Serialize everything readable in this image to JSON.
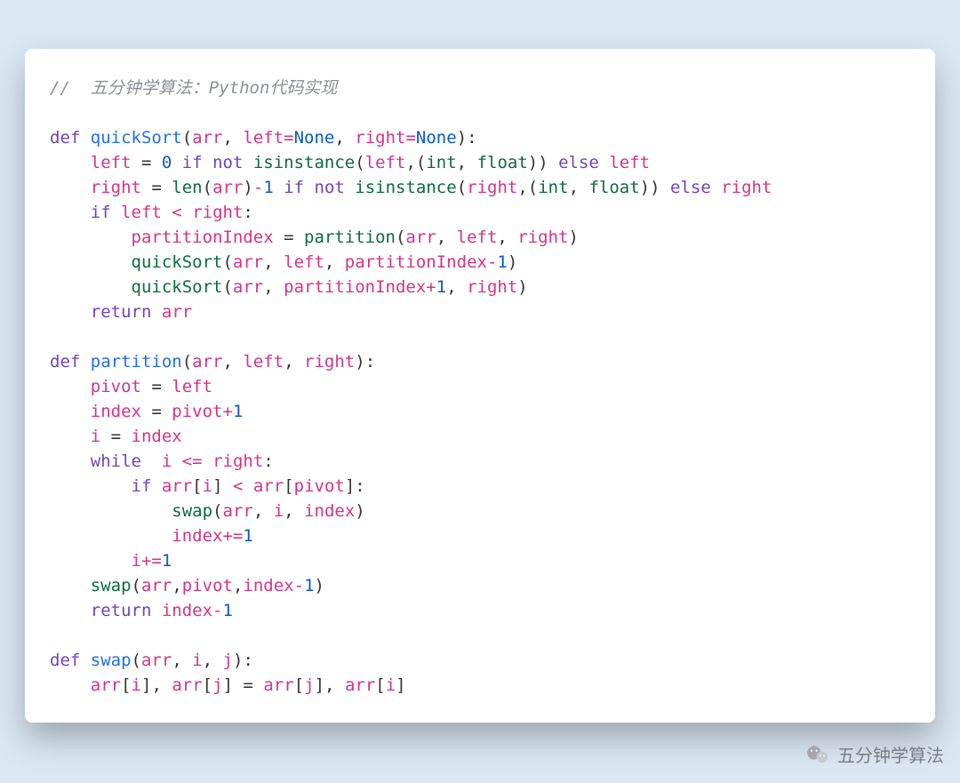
{
  "code": {
    "language": "python",
    "comment": "//  五分钟学算法：Python代码实现",
    "lines_plain": [
      "// 五分钟学算法：Python代码实现",
      "",
      "def quickSort(arr, left=None, right=None):",
      "    left = 0 if not isinstance(left,(int, float)) else left",
      "    right = len(arr)-1 if not isinstance(right,(int, float)) else right",
      "    if left < right:",
      "        partitionIndex = partition(arr, left, right)",
      "        quickSort(arr, left, partitionIndex-1)",
      "        quickSort(arr, partitionIndex+1, right)",
      "    return arr",
      "",
      "def partition(arr, left, right):",
      "    pivot = left",
      "    index = pivot+1",
      "    i = index",
      "    while  i <= right:",
      "        if arr[i] < arr[pivot]:",
      "            swap(arr, i, index)",
      "            index+=1",
      "        i+=1",
      "    swap(arr,pivot,index-1)",
      "    return index-1",
      "",
      "def swap(arr, i, j):",
      "    arr[i], arr[j] = arr[j], arr[i]"
    ],
    "lines": [
      [
        {
          "t": "//  五分钟学算法：Python代码实现",
          "c": "tok-comment"
        }
      ],
      [],
      [
        {
          "t": "def ",
          "c": "tok-kw"
        },
        {
          "t": "quickSort",
          "c": "tok-fn"
        },
        {
          "t": "(",
          "c": "tok-paren"
        },
        {
          "t": "arr",
          "c": "tok-name"
        },
        {
          "t": ", "
        },
        {
          "t": "left",
          "c": "tok-name"
        },
        {
          "t": "=",
          "c": "tok-op"
        },
        {
          "t": "None",
          "c": "tok-const"
        },
        {
          "t": ", "
        },
        {
          "t": "right",
          "c": "tok-name"
        },
        {
          "t": "=",
          "c": "tok-op"
        },
        {
          "t": "None",
          "c": "tok-const"
        },
        {
          "t": "):",
          "c": "tok-paren"
        }
      ],
      [
        {
          "t": "    "
        },
        {
          "t": "left",
          "c": "tok-name"
        },
        {
          "t": " = "
        },
        {
          "t": "0",
          "c": "tok-num"
        },
        {
          "t": " "
        },
        {
          "t": "if not ",
          "c": "tok-kw"
        },
        {
          "t": "isinstance",
          "c": "tok-call"
        },
        {
          "t": "(",
          "c": "tok-paren"
        },
        {
          "t": "left",
          "c": "tok-name"
        },
        {
          "t": ",("
        },
        {
          "t": "int",
          "c": "tok-call"
        },
        {
          "t": ", "
        },
        {
          "t": "float",
          "c": "tok-call"
        },
        {
          "t": "))",
          "c": "tok-paren"
        },
        {
          "t": " "
        },
        {
          "t": "else ",
          "c": "tok-kw"
        },
        {
          "t": "left",
          "c": "tok-name"
        }
      ],
      [
        {
          "t": "    "
        },
        {
          "t": "right",
          "c": "tok-name"
        },
        {
          "t": " = "
        },
        {
          "t": "len",
          "c": "tok-call"
        },
        {
          "t": "(",
          "c": "tok-paren"
        },
        {
          "t": "arr",
          "c": "tok-name"
        },
        {
          "t": ")",
          "c": "tok-paren"
        },
        {
          "t": "-",
          "c": "tok-op"
        },
        {
          "t": "1",
          "c": "tok-num"
        },
        {
          "t": " "
        },
        {
          "t": "if not ",
          "c": "tok-kw"
        },
        {
          "t": "isinstance",
          "c": "tok-call"
        },
        {
          "t": "(",
          "c": "tok-paren"
        },
        {
          "t": "right",
          "c": "tok-name"
        },
        {
          "t": ",("
        },
        {
          "t": "int",
          "c": "tok-call"
        },
        {
          "t": ", "
        },
        {
          "t": "float",
          "c": "tok-call"
        },
        {
          "t": "))",
          "c": "tok-paren"
        },
        {
          "t": " "
        },
        {
          "t": "else ",
          "c": "tok-kw"
        },
        {
          "t": "right",
          "c": "tok-name"
        }
      ],
      [
        {
          "t": "    "
        },
        {
          "t": "if ",
          "c": "tok-kw"
        },
        {
          "t": "left",
          "c": "tok-name"
        },
        {
          "t": " < ",
          "c": "tok-op"
        },
        {
          "t": "right",
          "c": "tok-name"
        },
        {
          "t": ":",
          "c": "tok-paren"
        }
      ],
      [
        {
          "t": "        "
        },
        {
          "t": "partitionIndex",
          "c": "tok-name"
        },
        {
          "t": " = "
        },
        {
          "t": "partition",
          "c": "tok-call"
        },
        {
          "t": "(",
          "c": "tok-paren"
        },
        {
          "t": "arr",
          "c": "tok-name"
        },
        {
          "t": ", "
        },
        {
          "t": "left",
          "c": "tok-name"
        },
        {
          "t": ", "
        },
        {
          "t": "right",
          "c": "tok-name"
        },
        {
          "t": ")",
          "c": "tok-paren"
        }
      ],
      [
        {
          "t": "        "
        },
        {
          "t": "quickSort",
          "c": "tok-call"
        },
        {
          "t": "(",
          "c": "tok-paren"
        },
        {
          "t": "arr",
          "c": "tok-name"
        },
        {
          "t": ", "
        },
        {
          "t": "left",
          "c": "tok-name"
        },
        {
          "t": ", "
        },
        {
          "t": "partitionIndex",
          "c": "tok-name"
        },
        {
          "t": "-",
          "c": "tok-op"
        },
        {
          "t": "1",
          "c": "tok-num"
        },
        {
          "t": ")",
          "c": "tok-paren"
        }
      ],
      [
        {
          "t": "        "
        },
        {
          "t": "quickSort",
          "c": "tok-call"
        },
        {
          "t": "(",
          "c": "tok-paren"
        },
        {
          "t": "arr",
          "c": "tok-name"
        },
        {
          "t": ", "
        },
        {
          "t": "partitionIndex",
          "c": "tok-name"
        },
        {
          "t": "+",
          "c": "tok-op"
        },
        {
          "t": "1",
          "c": "tok-num"
        },
        {
          "t": ", "
        },
        {
          "t": "right",
          "c": "tok-name"
        },
        {
          "t": ")",
          "c": "tok-paren"
        }
      ],
      [
        {
          "t": "    "
        },
        {
          "t": "return ",
          "c": "tok-kw"
        },
        {
          "t": "arr",
          "c": "tok-name"
        }
      ],
      [],
      [
        {
          "t": "def ",
          "c": "tok-kw"
        },
        {
          "t": "partition",
          "c": "tok-fn"
        },
        {
          "t": "(",
          "c": "tok-paren"
        },
        {
          "t": "arr",
          "c": "tok-name"
        },
        {
          "t": ", "
        },
        {
          "t": "left",
          "c": "tok-name"
        },
        {
          "t": ", "
        },
        {
          "t": "right",
          "c": "tok-name"
        },
        {
          "t": "):",
          "c": "tok-paren"
        }
      ],
      [
        {
          "t": "    "
        },
        {
          "t": "pivot",
          "c": "tok-name"
        },
        {
          "t": " = "
        },
        {
          "t": "left",
          "c": "tok-name"
        }
      ],
      [
        {
          "t": "    "
        },
        {
          "t": "index",
          "c": "tok-name"
        },
        {
          "t": " = "
        },
        {
          "t": "pivot",
          "c": "tok-name"
        },
        {
          "t": "+",
          "c": "tok-op"
        },
        {
          "t": "1",
          "c": "tok-num"
        }
      ],
      [
        {
          "t": "    "
        },
        {
          "t": "i",
          "c": "tok-name"
        },
        {
          "t": " = "
        },
        {
          "t": "index",
          "c": "tok-name"
        }
      ],
      [
        {
          "t": "    "
        },
        {
          "t": "while  ",
          "c": "tok-kw"
        },
        {
          "t": "i",
          "c": "tok-name"
        },
        {
          "t": " <= ",
          "c": "tok-op"
        },
        {
          "t": "right",
          "c": "tok-name"
        },
        {
          "t": ":",
          "c": "tok-paren"
        }
      ],
      [
        {
          "t": "        "
        },
        {
          "t": "if ",
          "c": "tok-kw"
        },
        {
          "t": "arr",
          "c": "tok-name"
        },
        {
          "t": "[",
          "c": "tok-paren"
        },
        {
          "t": "i",
          "c": "tok-name"
        },
        {
          "t": "]",
          "c": "tok-paren"
        },
        {
          "t": " < ",
          "c": "tok-op"
        },
        {
          "t": "arr",
          "c": "tok-name"
        },
        {
          "t": "[",
          "c": "tok-paren"
        },
        {
          "t": "pivot",
          "c": "tok-name"
        },
        {
          "t": "]:",
          "c": "tok-paren"
        }
      ],
      [
        {
          "t": "            "
        },
        {
          "t": "swap",
          "c": "tok-call"
        },
        {
          "t": "(",
          "c": "tok-paren"
        },
        {
          "t": "arr",
          "c": "tok-name"
        },
        {
          "t": ", "
        },
        {
          "t": "i",
          "c": "tok-name"
        },
        {
          "t": ", "
        },
        {
          "t": "index",
          "c": "tok-name"
        },
        {
          "t": ")",
          "c": "tok-paren"
        }
      ],
      [
        {
          "t": "            "
        },
        {
          "t": "index",
          "c": "tok-name"
        },
        {
          "t": "+=",
          "c": "tok-op"
        },
        {
          "t": "1",
          "c": "tok-num"
        }
      ],
      [
        {
          "t": "        "
        },
        {
          "t": "i",
          "c": "tok-name"
        },
        {
          "t": "+=",
          "c": "tok-op"
        },
        {
          "t": "1",
          "c": "tok-num"
        }
      ],
      [
        {
          "t": "    "
        },
        {
          "t": "swap",
          "c": "tok-call"
        },
        {
          "t": "(",
          "c": "tok-paren"
        },
        {
          "t": "arr",
          "c": "tok-name"
        },
        {
          "t": ","
        },
        {
          "t": "pivot",
          "c": "tok-name"
        },
        {
          "t": ","
        },
        {
          "t": "index",
          "c": "tok-name"
        },
        {
          "t": "-",
          "c": "tok-op"
        },
        {
          "t": "1",
          "c": "tok-num"
        },
        {
          "t": ")",
          "c": "tok-paren"
        }
      ],
      [
        {
          "t": "    "
        },
        {
          "t": "return ",
          "c": "tok-kw"
        },
        {
          "t": "index",
          "c": "tok-name"
        },
        {
          "t": "-",
          "c": "tok-op"
        },
        {
          "t": "1",
          "c": "tok-num"
        }
      ],
      [],
      [
        {
          "t": "def ",
          "c": "tok-kw"
        },
        {
          "t": "swap",
          "c": "tok-fn"
        },
        {
          "t": "(",
          "c": "tok-paren"
        },
        {
          "t": "arr",
          "c": "tok-name"
        },
        {
          "t": ", "
        },
        {
          "t": "i",
          "c": "tok-name"
        },
        {
          "t": ", "
        },
        {
          "t": "j",
          "c": "tok-name"
        },
        {
          "t": "):",
          "c": "tok-paren"
        }
      ],
      [
        {
          "t": "    "
        },
        {
          "t": "arr",
          "c": "tok-name"
        },
        {
          "t": "[",
          "c": "tok-paren"
        },
        {
          "t": "i",
          "c": "tok-name"
        },
        {
          "t": "]",
          "c": "tok-paren"
        },
        {
          "t": ", "
        },
        {
          "t": "arr",
          "c": "tok-name"
        },
        {
          "t": "[",
          "c": "tok-paren"
        },
        {
          "t": "j",
          "c": "tok-name"
        },
        {
          "t": "]",
          "c": "tok-paren"
        },
        {
          "t": " = "
        },
        {
          "t": "arr",
          "c": "tok-name"
        },
        {
          "t": "[",
          "c": "tok-paren"
        },
        {
          "t": "j",
          "c": "tok-name"
        },
        {
          "t": "]",
          "c": "tok-paren"
        },
        {
          "t": ", "
        },
        {
          "t": "arr",
          "c": "tok-name"
        },
        {
          "t": "[",
          "c": "tok-paren"
        },
        {
          "t": "i",
          "c": "tok-name"
        },
        {
          "t": "]",
          "c": "tok-paren"
        }
      ]
    ]
  },
  "watermark": {
    "text": "五分钟学算法",
    "icon": "wechat-icon"
  }
}
